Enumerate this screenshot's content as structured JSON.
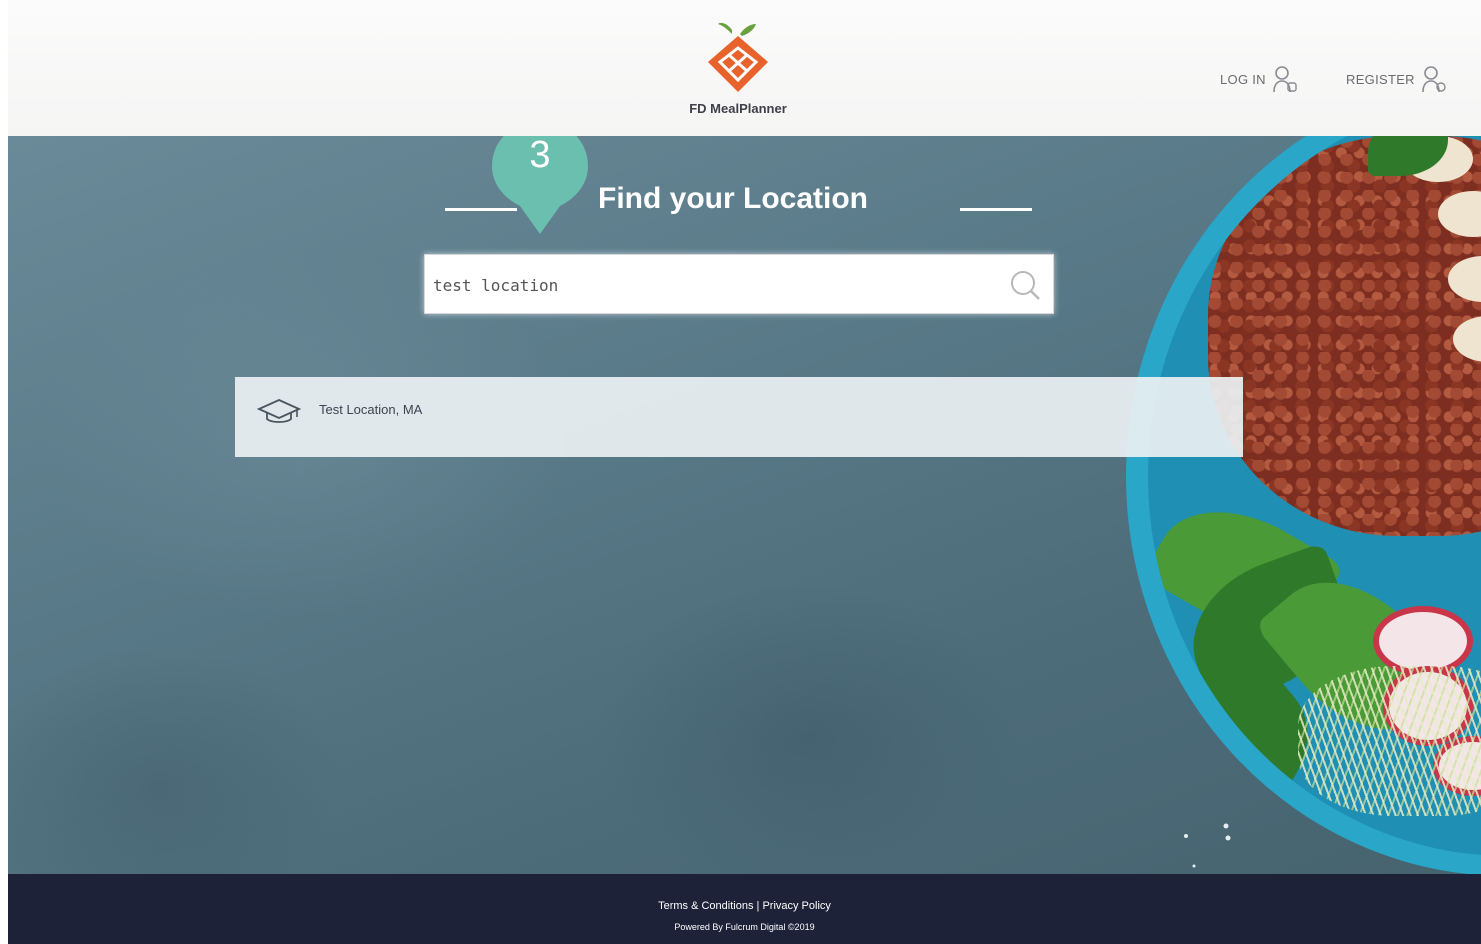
{
  "header": {
    "logo_text": "FD MealPlanner",
    "login_label": "LOG IN",
    "register_label": "REGISTER",
    "icons": [
      "logo-icon",
      "user-icon",
      "user-icon"
    ]
  },
  "hero": {
    "title": "Find your Location",
    "step_number": "3",
    "search": {
      "value": "test location",
      "icon": "search-icon"
    },
    "results": [
      {
        "label": "Test Location, MA",
        "icon": "graduation-cap-icon"
      }
    ]
  },
  "footer": {
    "terms_label": "Terms & Conditions",
    "separator": "|",
    "privacy_label": "Privacy Policy",
    "powered_by": "Powered By Fulcrum Digital ©2019"
  },
  "colors": {
    "accent_teal": "#6bbfae",
    "logo_orange": "#e8632c",
    "logo_green": "#6aa040",
    "footer_bg": "#1d2239",
    "hero_bg": "#587987"
  }
}
